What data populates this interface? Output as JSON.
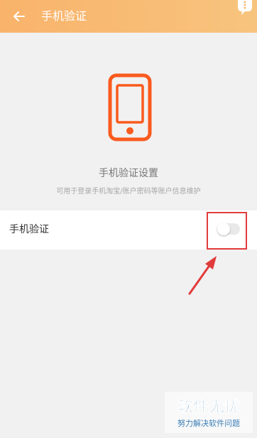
{
  "header": {
    "title": "手机验证",
    "back_icon": "arrow-left-icon",
    "more_icon": "more-icon"
  },
  "intro": {
    "illustration": "smartphone-icon",
    "heading": "手机验证设置",
    "description": "可用于登录手机淘宝/账户密码等账户信息维护"
  },
  "settings": {
    "items": [
      {
        "label": "手机验证",
        "enabled": false
      }
    ]
  },
  "annotation": {
    "highlight_color": "#e23b3b"
  },
  "watermark": {
    "brand": "软件无忧",
    "slogan": "努力解决软件问题"
  },
  "colors": {
    "header_start": "#f9b36b",
    "header_end": "#f7c47e",
    "accent": "#fa5a1e",
    "background": "#f1f1f1"
  }
}
